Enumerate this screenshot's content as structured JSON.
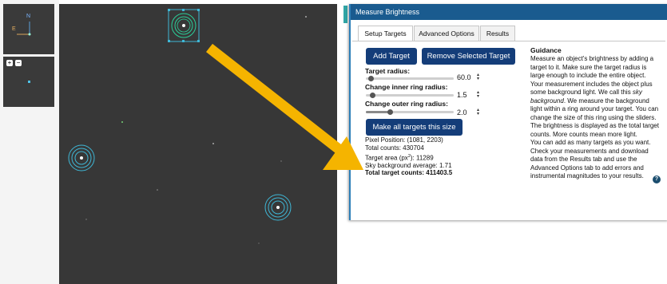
{
  "navigator": {
    "compass_north": "N",
    "compass_east": "E",
    "zoom_in_label": "+",
    "zoom_out_label": "−"
  },
  "dialog": {
    "title": "Measure Brightness",
    "tabs": [
      {
        "label": "Setup Targets",
        "active": true
      },
      {
        "label": "Advanced Options",
        "active": false
      },
      {
        "label": "Results",
        "active": false
      }
    ],
    "buttons": {
      "add_target": "Add Target",
      "remove_selected": "Remove Selected Target",
      "make_all_same": "Make all targets this size"
    },
    "sliders": {
      "target_radius": {
        "label": "Target radius:",
        "value": "60.0",
        "fraction": 0.05
      },
      "inner_ring": {
        "label": "Change inner ring radius:",
        "value": "1.5",
        "fraction": 0.1
      },
      "outer_ring": {
        "label": "Change outer ring radius:",
        "value": "2.0",
        "fraction": 0.3
      }
    },
    "readout": {
      "pixel_position": "Pixel Position: (1081, 2203)",
      "total_counts": "Total counts: 430704",
      "target_area_prefix": "Target area (px",
      "target_area_sup": "2",
      "target_area_suffix": "): 11289",
      "sky_background": "Sky background average: 1.71",
      "total_target_counts": "Total target counts: 411403.5"
    },
    "guidance": {
      "heading": "Guidance",
      "p1": "Measure an object's brightness by adding a target to it. Make sure the target radius is large enough to include the entire object.",
      "p2_a": "Your measurement includes the object plus some background light. We call this ",
      "p2_em": "sky background",
      "p2_b": ". We measure the background light within a ring around your target. You can change the size of this ring using the sliders.",
      "p3": "The brightness is displayed as the total target counts. More counts mean more light.",
      "p4": "You can add as many targets as you want. Check your measurements and download data from the Results tab and use the Advanced Options tab to add errors and instrumental magnitudes to your results.",
      "help_icon": "?"
    }
  },
  "colors": {
    "sky": "#373737",
    "dialog_title": "#1a5b8f",
    "button": "#143d79",
    "arrow": "#f5b400",
    "target_ring": "#3fb7d6",
    "selected_ring": "#2bd09a"
  }
}
